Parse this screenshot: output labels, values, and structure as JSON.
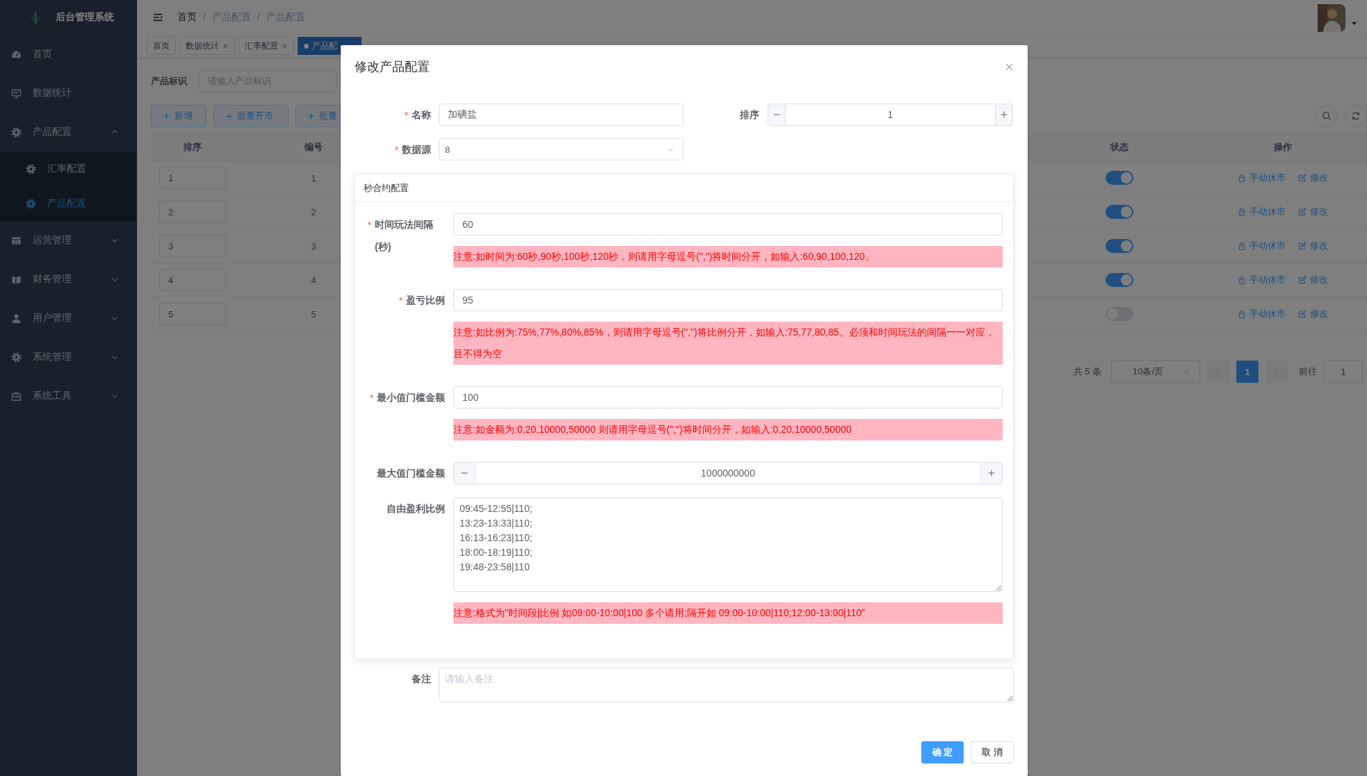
{
  "app": {
    "title": "后台管理系统"
  },
  "sidebar": {
    "items": [
      {
        "label": "首页",
        "kind": "link",
        "selected": false
      },
      {
        "label": "数据统计",
        "kind": "link",
        "selected": false
      },
      {
        "label": "产品配置",
        "kind": "group",
        "expanded": true,
        "selected": false,
        "children": [
          {
            "label": "汇率配置",
            "selected": false
          },
          {
            "label": "产品配置",
            "selected": true
          }
        ]
      },
      {
        "label": "运营管理",
        "kind": "group",
        "expanded": false,
        "selected": false
      },
      {
        "label": "财务管理",
        "kind": "group",
        "expanded": false,
        "selected": false
      },
      {
        "label": "用户管理",
        "kind": "group",
        "expanded": false,
        "selected": false
      },
      {
        "label": "系统管理",
        "kind": "group",
        "expanded": false,
        "selected": false
      },
      {
        "label": "系统工具",
        "kind": "group",
        "expanded": false,
        "selected": false
      }
    ]
  },
  "breadcrumb": {
    "separator": "/",
    "items": [
      "首页",
      "产品配置",
      "产品配置"
    ]
  },
  "tabs": [
    {
      "label": "首页",
      "closable": false,
      "selected": false
    },
    {
      "label": "数据统计",
      "closable": true,
      "selected": false
    },
    {
      "label": "汇率配置",
      "closable": true,
      "selected": false
    },
    {
      "label": "产品配",
      "closable": false,
      "selected": true
    }
  ],
  "filter": {
    "label": "产品标识",
    "placeholder": "请输入产品标识"
  },
  "toolbar": {
    "buttons": [
      "新增",
      "批量开市",
      "批量"
    ]
  },
  "table": {
    "columns": [
      "排序",
      "编号",
      "状态",
      "操作"
    ],
    "rows": [
      {
        "sort": "1",
        "number": "1",
        "enabled": true,
        "actions": [
          "手动休市",
          "修改"
        ]
      },
      {
        "sort": "2",
        "number": "2",
        "enabled": true,
        "actions": [
          "手动休市",
          "修改"
        ]
      },
      {
        "sort": "3",
        "number": "3",
        "enabled": true,
        "actions": [
          "手动休市",
          "修改"
        ]
      },
      {
        "sort": "4",
        "number": "4",
        "enabled": true,
        "actions": [
          "手动休市",
          "修改"
        ]
      },
      {
        "sort": "5",
        "number": "5",
        "enabled": false,
        "actions": [
          "手动休市",
          "修改"
        ]
      }
    ]
  },
  "pagination": {
    "total": "共 5 条",
    "page_size": "10条/页",
    "pages": [
      {
        "label": "1",
        "selected": true
      }
    ],
    "goto_label": "前往",
    "goto_value": "1"
  },
  "dialog": {
    "title": "修改产品配置",
    "name": {
      "label": "名称",
      "required": true,
      "value": "加碘盐"
    },
    "sort": {
      "label": "排序",
      "required": false,
      "value": "1"
    },
    "data_source": {
      "label": "数据源",
      "required": true,
      "value": "8"
    },
    "section": {
      "title": "秒合约配置",
      "fields": [
        {
          "kind": "input",
          "label": "时间玩法间隔(秒)",
          "required": true,
          "value": "60",
          "note": "注意:如时间为:60秒,90秒,100秒,120秒，则请用字母逗号(\",\")将时间分开，如输入:60,90,100,120。"
        },
        {
          "kind": "input",
          "label": "盈亏比例",
          "required": true,
          "value": "95",
          "note": "注意:如比例为:75%,77%,80%,85%，则请用字母逗号(\",\")将比例分开，如输入:75,77,80,85。必须和时间玩法的间隔一一对应，且不得为空"
        },
        {
          "kind": "input",
          "label": "最小值门槛金额",
          "required": true,
          "value": "100",
          "note": "注意:如金额为:0,20,10000,50000 则请用字母逗号(\",\")将时间分开，如输入:0,20,10000,50000"
        },
        {
          "kind": "number",
          "label": "最大值门槛金额",
          "required": false,
          "value": "1000000000"
        },
        {
          "kind": "textarea",
          "label": "自由盈利比例",
          "required": false,
          "value": "09:45-12:55|110;\n13:23-13:33|110;\n16:13-16:23|110;\n18:00-18:19|110;\n19:48-23:58|110",
          "note": "注意:格式为\"时间段|比例 如09:00-10:00|100 多个请用;隔开如 09:00-10:00|110;12:00-13:00|110\""
        }
      ]
    },
    "remark": {
      "label": "备注",
      "placeholder": "请输入备注"
    },
    "buttons": [
      {
        "label": "确 定",
        "kind": "primary"
      },
      {
        "label": "取 消",
        "kind": "default"
      }
    ]
  }
}
